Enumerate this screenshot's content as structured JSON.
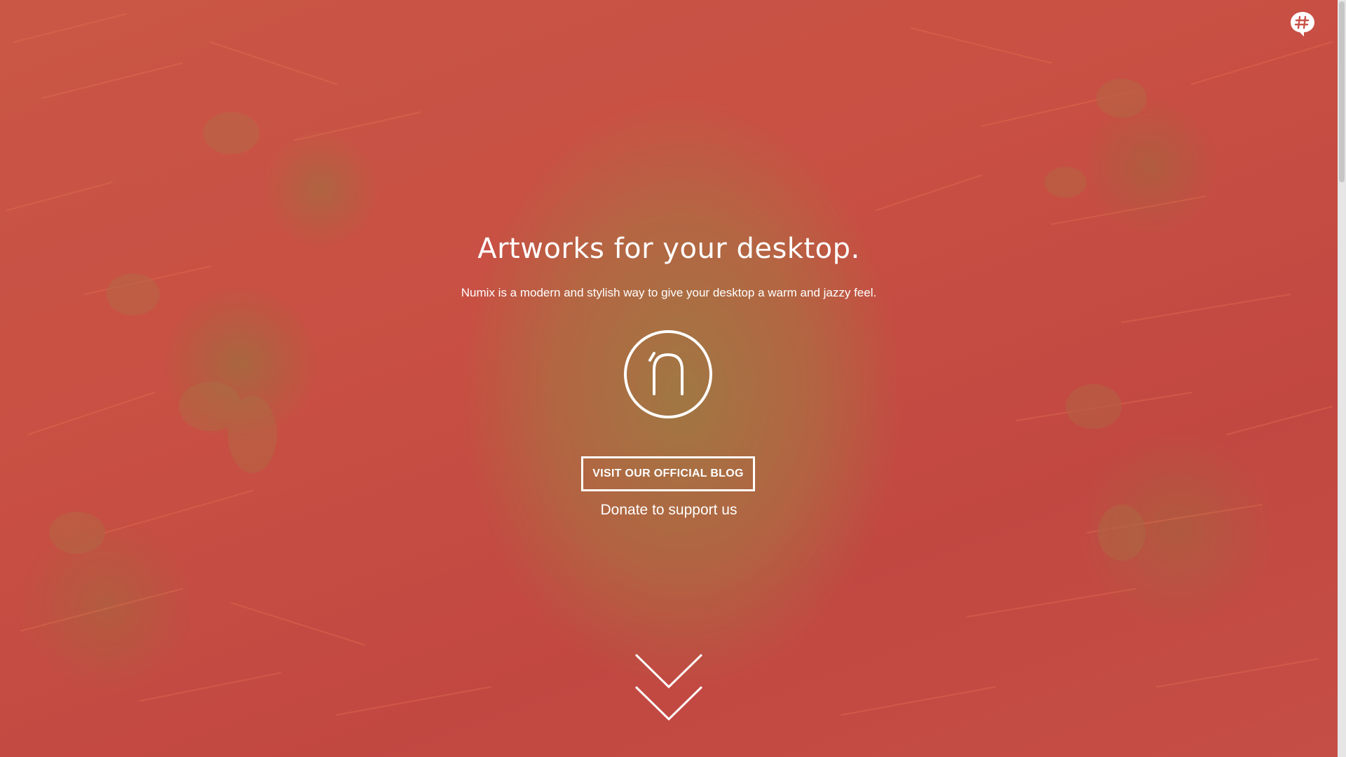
{
  "hero": {
    "title": "Artworks for your desktop.",
    "subtitle": "Numix is a modern and stylish way to give your desktop a warm and jazzy feel.",
    "logo_icon": "numix-logo-icon",
    "blog_button_label": "VISIT OUR OFFICIAL BLOG",
    "donate_link_label": "Donate to support us",
    "scroll_icon": "double-chevron-down-icon"
  },
  "corner": {
    "icon": "hash-chat-bubble-icon"
  },
  "colors": {
    "overlay_accent": "#c9524a",
    "foreground": "#ffffff"
  }
}
